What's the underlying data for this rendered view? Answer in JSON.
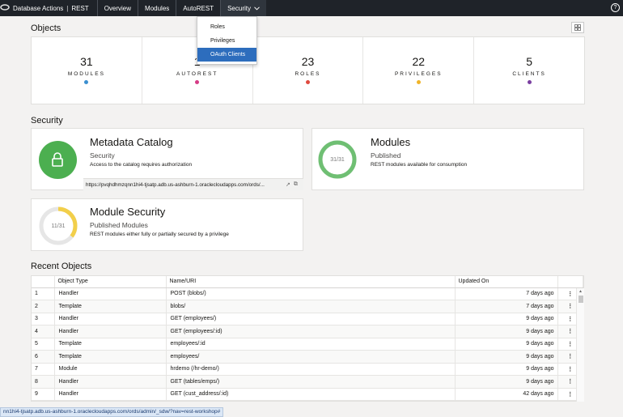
{
  "topbar": {
    "logo": "ORACLE",
    "app_title": "Database Actions",
    "separator": "|",
    "app_context": "REST",
    "nav": [
      {
        "label": "Overview"
      },
      {
        "label": "Modules"
      },
      {
        "label": "AutoREST"
      },
      {
        "label": "Security",
        "chevron": "chevron-down-icon"
      }
    ],
    "help_icon": "?"
  },
  "security_menu": {
    "options": [
      "Roles",
      "Privileges",
      "OAuth Clients"
    ],
    "selected": "OAuth Clients"
  },
  "objects": {
    "title": "Objects",
    "counters": [
      {
        "value": "31",
        "label": "MODULES",
        "color": "#3b8fd0"
      },
      {
        "value": "1",
        "label": "AUTOREST",
        "color": "#d63b86"
      },
      {
        "value": "23",
        "label": "ROLES",
        "color": "#e04a3f"
      },
      {
        "value": "22",
        "label": "PRIVILEGES",
        "color": "#f0b429"
      },
      {
        "value": "5",
        "label": "CLIENTS",
        "color": "#7a3fa0"
      }
    ]
  },
  "security": {
    "title": "Security",
    "metadata_catalog": {
      "title": "Metadata Catalog",
      "subtitle": "Security",
      "description": "Access to the catalog requires authorization",
      "url": "https://pvqhdhmzqnn1hi4-tjsatp.adb.us-ashburn-1.oraclecloudapps.com/ords/...",
      "icon_color": "#4caf50"
    },
    "modules": {
      "title": "Modules",
      "subtitle": "Published",
      "description": "REST modules available for consumption",
      "ring_text": "31/31",
      "ring_fraction": 1.0,
      "ring_color": "#6fbf73"
    },
    "module_security": {
      "title": "Module Security",
      "subtitle": "Published Modules",
      "description": "REST modules either fully or partially secured by a privilege",
      "ring_text": "11/31",
      "ring_fraction": 0.355,
      "ring_color": "#f2cf4a"
    }
  },
  "recent": {
    "title": "Recent Objects",
    "columns": [
      "",
      "Object Type",
      "Name/URI",
      "Updated On",
      ""
    ],
    "rows": [
      {
        "n": "1",
        "type": "Handler",
        "name": "POST (blobs/)",
        "updated": "7 days ago"
      },
      {
        "n": "2",
        "type": "Template",
        "name": "blobs/",
        "updated": "7 days ago"
      },
      {
        "n": "3",
        "type": "Handler",
        "name": "GET (employees/)",
        "updated": "9 days ago"
      },
      {
        "n": "4",
        "type": "Handler",
        "name": "GET (employees/:id)",
        "updated": "9 days ago"
      },
      {
        "n": "5",
        "type": "Template",
        "name": "employees/:id",
        "updated": "9 days ago"
      },
      {
        "n": "6",
        "type": "Template",
        "name": "employees/",
        "updated": "9 days ago"
      },
      {
        "n": "7",
        "type": "Module",
        "name": "hrdemo (/hr-demo/)",
        "updated": "9 days ago"
      },
      {
        "n": "8",
        "type": "Handler",
        "name": "GET (tables/emps/)",
        "updated": "9 days ago"
      },
      {
        "n": "9",
        "type": "Handler",
        "name": "GET (cust_address/:id)",
        "updated": "42 days ago"
      }
    ],
    "kebab": "⋮"
  },
  "statusbar": {
    "text": "nn1hi4-tjsatp.adb.us-ashburn-1.oraclecloudapps.com/ords/admin/_sdw/?nav=rest-workshop#"
  }
}
